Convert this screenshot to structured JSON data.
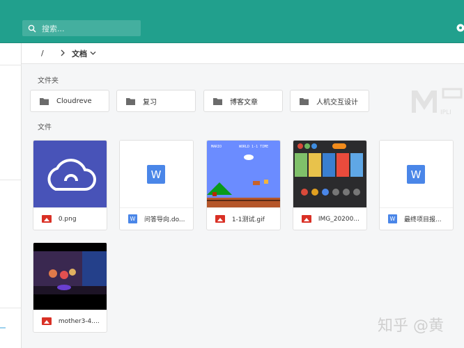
{
  "search": {
    "placeholder": "搜索..."
  },
  "breadcrumb": {
    "root": "/",
    "current": "文档"
  },
  "sections": {
    "folders": "文件夹",
    "files": "文件"
  },
  "folders": [
    {
      "name": "Cloudreve"
    },
    {
      "name": "复习"
    },
    {
      "name": "博客文章"
    },
    {
      "name": "人机交互设计"
    }
  ],
  "files": [
    {
      "name": "0.png",
      "type": "image"
    },
    {
      "name": "问答导向.do...",
      "type": "doc"
    },
    {
      "name": "1-1测试.gif",
      "type": "image"
    },
    {
      "name": "IMG_20200...",
      "type": "image"
    },
    {
      "name": "最终项目报...",
      "type": "doc"
    },
    {
      "name": "mother3-4....",
      "type": "image"
    }
  ],
  "thumbs": {
    "doc_letter": "W",
    "doc_badge": "W",
    "cloud_color": "#4853b8",
    "game_label": "MARIO",
    "game_stats": "WORLD 1-1 TIME"
  },
  "colors": {
    "accent": "#21a08d",
    "image_icon": "#d93025",
    "doc_icon": "#4a86e8"
  },
  "watermark": {
    "logo": "IPLI",
    "text": "知乎 @黄"
  }
}
